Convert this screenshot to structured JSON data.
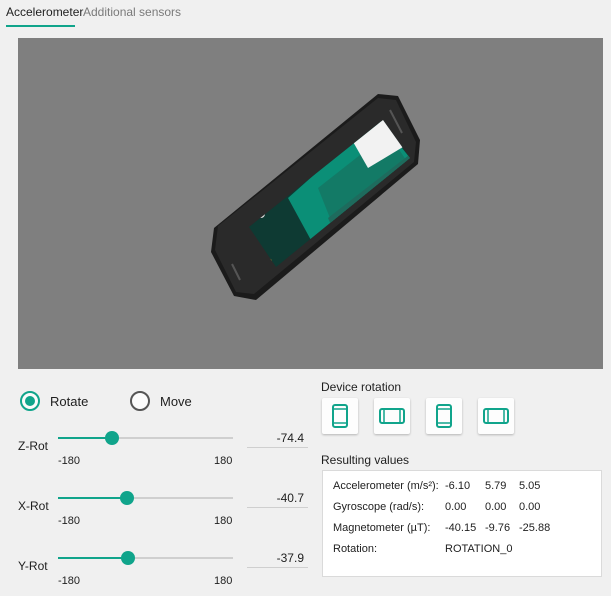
{
  "tabs": [
    {
      "label": "Accelerometer"
    },
    {
      "label": "Additional sensors"
    }
  ],
  "mode": {
    "rotate_label": "Rotate",
    "move_label": "Move",
    "selected": "Rotate"
  },
  "rotation": {
    "z": {
      "label": "Z-Rot",
      "min": "-180",
      "max": "180",
      "value": "-74.4"
    },
    "x": {
      "label": "X-Rot",
      "min": "-180",
      "max": "180",
      "value": "-40.7"
    },
    "y": {
      "label": "Y-Rot",
      "min": "-180",
      "max": "180",
      "value": "-37.9"
    }
  },
  "device_rotation": {
    "title": "Device rotation",
    "buttons": [
      "portrait-icon",
      "landscape-icon",
      "reverse-portrait-icon",
      "reverse-landscape-icon"
    ]
  },
  "results": {
    "title": "Resulting values",
    "rows": [
      {
        "label": "Accelerometer (m/s²):",
        "v1": "-6.10",
        "v2": "5.79",
        "v3": "5.05"
      },
      {
        "label": "Gyroscope (rad/s):",
        "v1": "0.00",
        "v2": "0.00",
        "v3": "0.00"
      },
      {
        "label": "Magnetometer (µT):",
        "v1": "-40.15",
        "v2": "-9.76",
        "v3": "-25.88"
      },
      {
        "label": "Rotation:",
        "v1": "ROTATION_0",
        "v2": "",
        "v3": ""
      }
    ]
  },
  "colors": {
    "accent": "#10a48b",
    "viewport_bg": "#7f7f7f"
  }
}
